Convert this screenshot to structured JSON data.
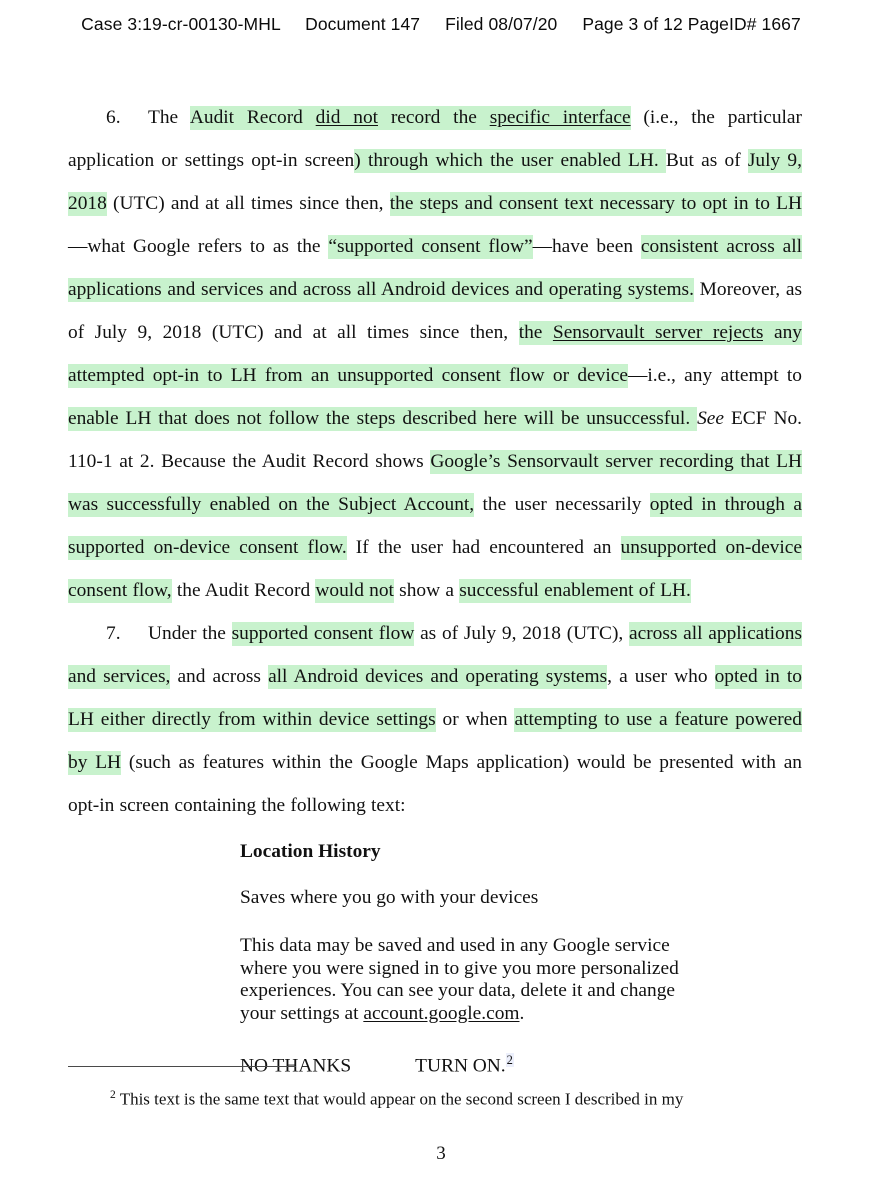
{
  "document": {
    "type": "court-filing-page",
    "highlight_color": "#c8f2cd",
    "text_color": "#111111",
    "page_background": "#ffffff"
  },
  "header": {
    "case": "Case 3:19-cr-00130-MHL",
    "document": "Document 147",
    "filed": "Filed 08/07/20",
    "page": "Page 3 of 12 PageID# 1667"
  },
  "paragraph_6": {
    "number": "6.",
    "runs": [
      {
        "text": "The ",
        "highlight": false
      },
      {
        "text": "Audit Record ",
        "highlight": true
      },
      {
        "text": "did not",
        "highlight": true,
        "underline": true
      },
      {
        "text": " record the ",
        "highlight": true
      },
      {
        "text": "specific interface",
        "highlight": true,
        "underline": true
      },
      {
        "text": " (i.e., the particular application or settings opt-in screen",
        "highlight": false
      },
      {
        "text": ") through which the user enabled LH.  ",
        "highlight": true
      },
      {
        "text": "But as of ",
        "highlight": false
      },
      {
        "text": "July 9, 2018",
        "highlight": true
      },
      {
        "text": " (UTC) and at all times since then, ",
        "highlight": false
      },
      {
        "text": "the steps and consent text necessary to opt in to LH",
        "highlight": true
      },
      {
        "text": "—what Google refers to as the ",
        "highlight": false
      },
      {
        "text": "“supported consent flow”",
        "highlight": true
      },
      {
        "text": "—have been ",
        "highlight": false
      },
      {
        "text": "consistent across all applications and services and across all Android devices and operating systems.",
        "highlight": true
      },
      {
        "text": "  Moreover, as of July 9, 2018 (UTC) and at all times since then, ",
        "highlight": false
      },
      {
        "text": "the ",
        "highlight": true
      },
      {
        "text": "Sensorvault server rejects",
        "highlight": true,
        "underline": true
      },
      {
        "text": " any attempted opt-in to LH from an unsupported consent flow or device",
        "highlight": true
      },
      {
        "text": "—i.e., any attempt to ",
        "highlight": false
      },
      {
        "text": "enable LH that does not follow the steps described here will be unsuccessful. ",
        "highlight": true
      },
      {
        "text": " ",
        "highlight": false
      },
      {
        "text": "See",
        "highlight": false,
        "italic": true
      },
      {
        "text": " ECF No. 110-1 at 2.  Because the Audit Record shows ",
        "highlight": false
      },
      {
        "text": "Google’s Sensorvault server recording that LH was successfully enabled on the Subject Account,",
        "highlight": true
      },
      {
        "text": " the user necessarily ",
        "highlight": false
      },
      {
        "text": "opted in through a supported on-device consent flow.",
        "highlight": true
      },
      {
        "text": "  If the user had encountered an ",
        "highlight": false
      },
      {
        "text": "unsupported on-device consent flow,",
        "highlight": true
      },
      {
        "text": " the Audit Record ",
        "highlight": false
      },
      {
        "text": "would not",
        "highlight": true
      },
      {
        "text": " show a ",
        "highlight": false
      },
      {
        "text": "successful enablement of LH. ",
        "highlight": true
      }
    ]
  },
  "paragraph_7": {
    "number": "7.",
    "runs": [
      {
        "text": "Under the ",
        "highlight": false
      },
      {
        "text": "supported consent flow",
        "highlight": true
      },
      {
        "text": " as of July 9, 2018 (UTC), ",
        "highlight": false
      },
      {
        "text": "across all applications and services,",
        "highlight": true
      },
      {
        "text": " and across ",
        "highlight": false
      },
      {
        "text": "all Android devices and operating systems",
        "highlight": true
      },
      {
        "text": ", a user who ",
        "highlight": false
      },
      {
        "text": "opted in to LH either directly from within device settings",
        "highlight": true
      },
      {
        "text": " or when ",
        "highlight": false
      },
      {
        "text": "attempting to use a feature powered by LH",
        "highlight": true
      },
      {
        "text": " (such as features within the Google Maps application) would be presented with an opt-in screen containing the following text:",
        "highlight": false
      }
    ]
  },
  "optin_screen": {
    "heading": "Location History",
    "subtitle": "Saves where you go with your devices",
    "body_before_link": "This data may be saved and used in any Google service where you were signed in to give you more personalized experiences.  You can see your data, delete it and change your settings at ",
    "body_link": "account.google.com",
    "body_after_link": ".",
    "decline_button": "NO THANKS",
    "accept_button": "TURN ON.",
    "footnote_marker": "2"
  },
  "footnote": {
    "marker": "2",
    "text": "This text is the same text that would appear on the second screen I described in my"
  },
  "page_number": "3"
}
